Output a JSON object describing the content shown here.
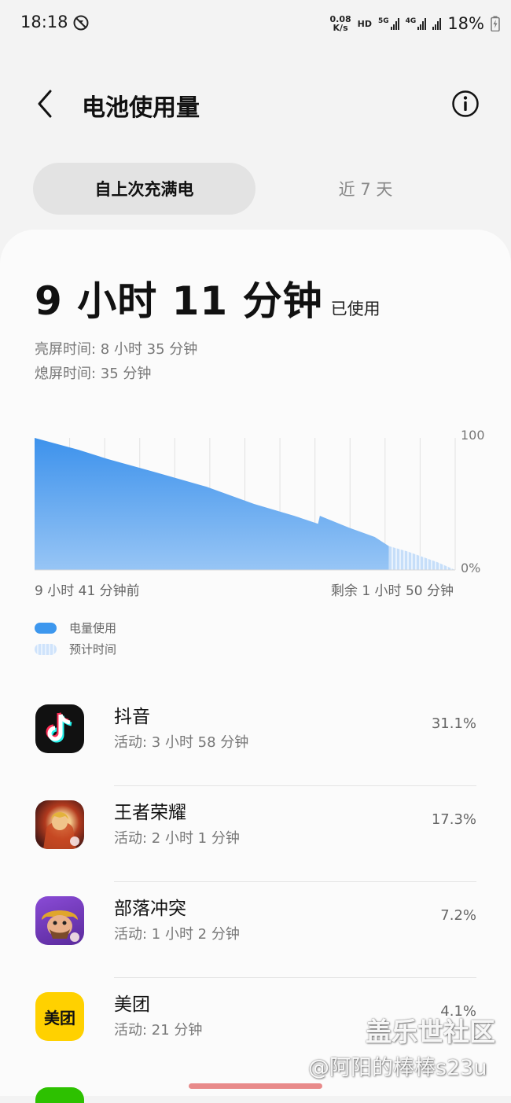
{
  "status_bar": {
    "time": "18:18",
    "net_speed_value": "0.08",
    "net_speed_unit": "K/s",
    "hd": "HD",
    "net1": "5G",
    "net2": "4G",
    "battery_pct": "18%"
  },
  "header": {
    "title": "电池使用量",
    "back_icon": "chevron-left-icon",
    "info_icon": "info-icon"
  },
  "tabs": [
    {
      "label": "自上次充满电",
      "active": true
    },
    {
      "label": "近 7 天",
      "active": false
    }
  ],
  "summary": {
    "usage_time": "9 小时 11 分钟",
    "usage_suffix": "已使用",
    "screen_on": "亮屏时间:  8 小时 35 分钟",
    "screen_off": "熄屏时间:   35 分钟"
  },
  "chart_data": {
    "type": "area",
    "y_top_label": "100",
    "y_bottom_label": "0%",
    "x_start_label": "9 小时 41 分钟前",
    "x_end_label": "剩余 1 小时 50 分钟",
    "ylim": [
      0,
      100
    ],
    "xlim": [
      0,
      11.5
    ],
    "series": [
      {
        "name": "电量使用",
        "x": [
          0,
          1.2,
          2.0,
          3.3,
          4.7,
          6.0,
          7.1,
          7.75,
          7.8,
          8.6,
          9.3,
          9.69
        ],
        "y": [
          100,
          91,
          84,
          74,
          63,
          50,
          41,
          35,
          41,
          32,
          25,
          18
        ]
      },
      {
        "name": "预计时间",
        "x": [
          9.69,
          10.2,
          11.0,
          11.5
        ],
        "y": [
          18,
          14,
          6,
          0
        ]
      }
    ],
    "grid": true,
    "legend": [
      {
        "label": "电量使用",
        "color": "#3d97ee"
      },
      {
        "label": "预计时间",
        "color": "#cfe3fb"
      }
    ]
  },
  "apps": [
    {
      "name": "抖音",
      "activity": "活动: 3 小时 58 分钟",
      "percent": "31.1%",
      "icon": "douyin-icon"
    },
    {
      "name": "王者荣耀",
      "activity": "活动: 2 小时 1 分钟",
      "percent": "17.3%",
      "icon": "honor-of-kings-icon"
    },
    {
      "name": "部落冲突",
      "activity": "活动: 1 小时 2 分钟",
      "percent": "7.2%",
      "icon": "clash-of-clans-icon"
    },
    {
      "name": "美团",
      "activity": "活动: 21 分钟",
      "percent": "4.1%",
      "icon": "meituan-icon",
      "icon_text": "美团"
    }
  ],
  "watermark": {
    "line1": "盖乐世社区",
    "line2": "@阿阳的棒棒s23u"
  }
}
